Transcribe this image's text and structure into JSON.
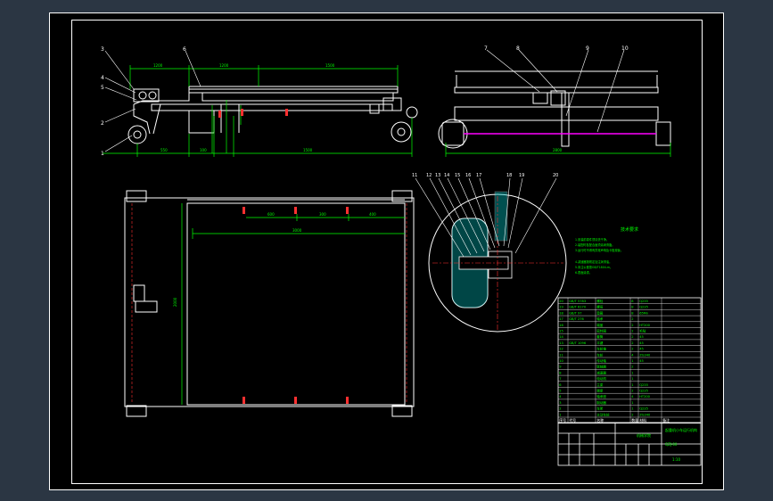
{
  "colors": {
    "background": "#2b3643",
    "sheet": "#000000",
    "line": "#ffffff",
    "dimension": "#00ff00",
    "accent_red": "#ff3030",
    "accent_cyan": "#00c8c8",
    "accent_magenta": "#ff00ff",
    "text_green": "#00ff00",
    "text_yellow": "#ffff00"
  },
  "views": {
    "front": {
      "callouts": [
        "3",
        "6",
        "4",
        "5",
        "2",
        "1"
      ],
      "dims": [
        "1200",
        "1200",
        "1500",
        "1500",
        "550",
        "100"
      ]
    },
    "side": {
      "callouts": [
        "7",
        "8",
        "9",
        "10"
      ],
      "dims": [
        "2800"
      ]
    },
    "plan": {
      "dims": [
        "600",
        "300",
        "400",
        "3000",
        "2000"
      ]
    },
    "detail": {
      "callouts": [
        "11",
        "12",
        "13",
        "14",
        "15",
        "16",
        "17",
        "18",
        "19",
        "20"
      ]
    }
  },
  "notes": {
    "title": "技术要求",
    "items": [
      "1.安装前零件须清洗干净。",
      "2.装配时各配合面须涂润滑脂。",
      "3.运行时不得有异常声响及卡阻现象。",
      "4.减速器按规定加注润滑油。",
      "5.未注公差按GB/T1804-m。",
      "6.表面涂漆。"
    ]
  },
  "parts_list": {
    "header": [
      "序号",
      "代号",
      "名称",
      "数量",
      "材料",
      "备注"
    ],
    "rows": [
      [
        "20",
        "GB/T 5783",
        "螺栓",
        "8",
        "Q235",
        ""
      ],
      [
        "19",
        "GB/T 6170",
        "螺母",
        "8",
        "Q235",
        ""
      ],
      [
        "18",
        "GB/T 97",
        "垫圈",
        "8",
        "65Mn",
        ""
      ],
      [
        "17",
        "GB/T 276",
        "轴承",
        "2",
        "",
        ""
      ],
      [
        "16",
        "",
        "端盖",
        "2",
        "HT200",
        ""
      ],
      [
        "15",
        "",
        "密封圈",
        "2",
        "毛毡",
        ""
      ],
      [
        "14",
        "",
        "套筒",
        "2",
        "45",
        ""
      ],
      [
        "13",
        "GB/T 1096",
        "平键",
        "2",
        "45",
        ""
      ],
      [
        "12",
        "",
        "车轮轴",
        "2",
        "45",
        ""
      ],
      [
        "11",
        "",
        "车轮",
        "4",
        "ZG340",
        ""
      ],
      [
        "10",
        "",
        "传动轴",
        "1",
        "45",
        ""
      ],
      [
        "9",
        "",
        "联轴器",
        "2",
        "",
        ""
      ],
      [
        "8",
        "",
        "减速器",
        "1",
        "",
        ""
      ],
      [
        "7",
        "",
        "电动机",
        "1",
        "",
        ""
      ],
      [
        "6",
        "",
        "主梁",
        "1",
        "Q235",
        ""
      ],
      [
        "5",
        "",
        "端梁",
        "2",
        "Q235",
        ""
      ],
      [
        "4",
        "",
        "轴承座",
        "4",
        "HT200",
        ""
      ],
      [
        "3",
        "",
        "制动器",
        "1",
        "",
        ""
      ],
      [
        "2",
        "",
        "车架",
        "1",
        "Q235",
        ""
      ],
      [
        "1",
        "",
        "主动车轮",
        "2",
        "ZG340",
        ""
      ]
    ]
  },
  "title_block": {
    "school": "机械学院",
    "title": "起重机小车运行机构",
    "drawing_no": "QZJ-00",
    "scale": "1:10"
  }
}
